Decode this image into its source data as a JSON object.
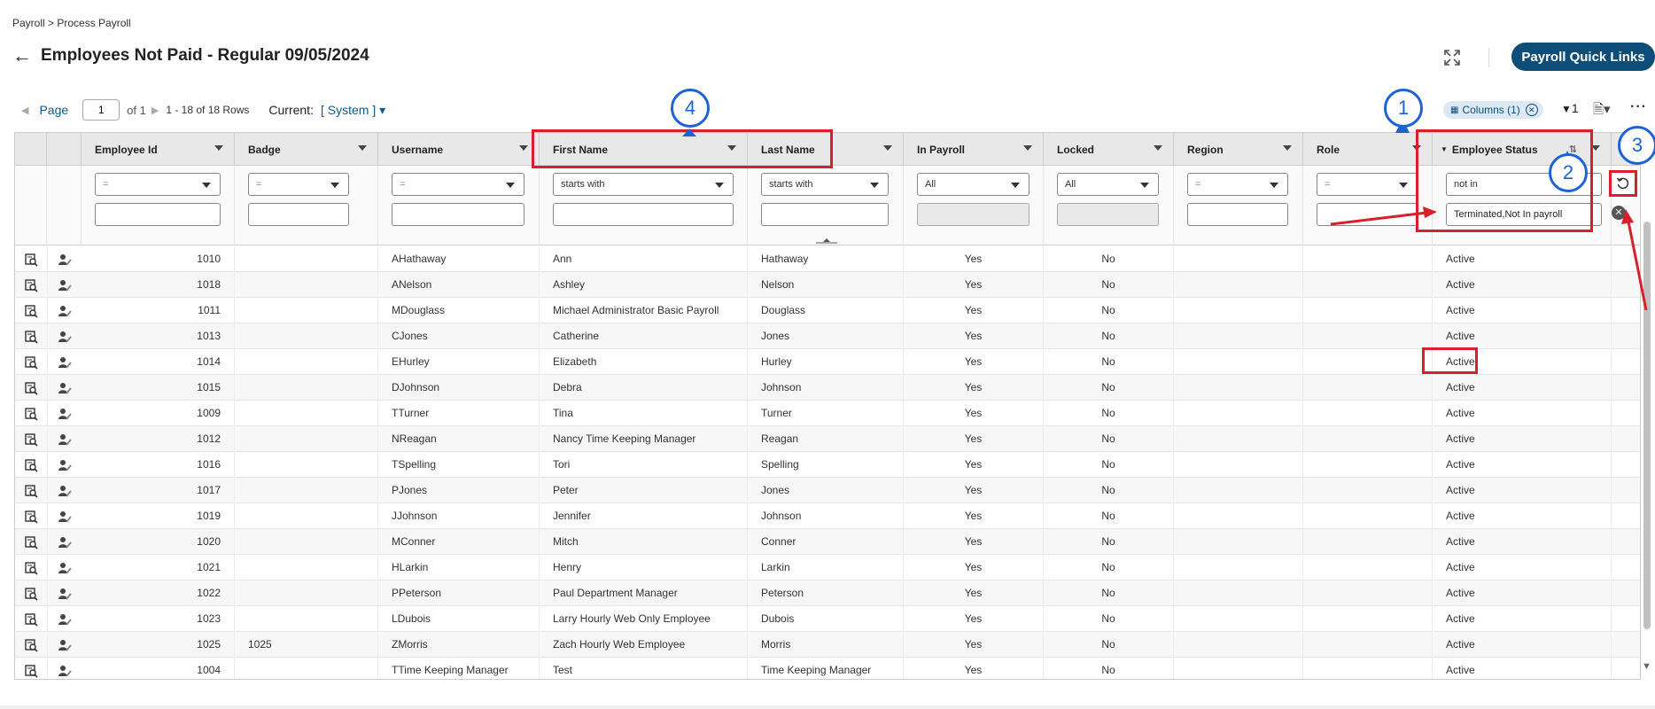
{
  "breadcrumb": "Payroll > Process Payroll",
  "title": "Employees Not Paid - Regular 09/05/2024",
  "quick_links": "Payroll Quick Links",
  "pager": {
    "page_label": "Page",
    "page_value": "1",
    "of_text": "of 1",
    "rows_text": "1 - 18 of 18 Rows",
    "current_label": "Current:",
    "current_value": "[ System ]"
  },
  "toolbar": {
    "columns_chip": "Columns (1)",
    "filter_count": "1"
  },
  "columns": [
    {
      "label": "Employee Id",
      "filter_op": "=",
      "op_placeholder": true,
      "filter_value": "",
      "disabled": false
    },
    {
      "label": "Badge",
      "filter_op": "=",
      "op_placeholder": true,
      "filter_value": "",
      "disabled": false
    },
    {
      "label": "Username",
      "filter_op": "=",
      "op_placeholder": true,
      "filter_value": "",
      "disabled": false
    },
    {
      "label": "First Name",
      "filter_op": "starts with",
      "op_placeholder": false,
      "filter_value": "",
      "disabled": false
    },
    {
      "label": "Last Name",
      "filter_op": "starts with",
      "op_placeholder": false,
      "filter_value": "",
      "disabled": false
    },
    {
      "label": "In Payroll",
      "filter_op": "All",
      "op_placeholder": false,
      "filter_value": "",
      "disabled": true
    },
    {
      "label": "Locked",
      "filter_op": "All",
      "op_placeholder": false,
      "filter_value": "",
      "disabled": true
    },
    {
      "label": "Region",
      "filter_op": "=",
      "op_placeholder": true,
      "filter_value": "",
      "disabled": false
    },
    {
      "label": "Role",
      "filter_op": "=",
      "op_placeholder": true,
      "filter_value": "",
      "disabled": false
    },
    {
      "label": "Employee Status",
      "filter_op": "not in",
      "op_placeholder": false,
      "filter_value": "Terminated,Not In payroll",
      "disabled": false
    }
  ],
  "rows": [
    {
      "id": "1010",
      "badge": "",
      "username": "AHathaway",
      "first": "Ann",
      "last": "Hathaway",
      "in_payroll": "Yes",
      "locked": "No",
      "region": "",
      "role": "",
      "status": "Active"
    },
    {
      "id": "1018",
      "badge": "",
      "username": "ANelson",
      "first": "Ashley",
      "last": "Nelson",
      "in_payroll": "Yes",
      "locked": "No",
      "region": "",
      "role": "",
      "status": "Active"
    },
    {
      "id": "1011",
      "badge": "",
      "username": "MDouglass",
      "first": "Michael Administrator Basic Payroll",
      "last": "Douglass",
      "in_payroll": "Yes",
      "locked": "No",
      "region": "",
      "role": "",
      "status": "Active"
    },
    {
      "id": "1013",
      "badge": "",
      "username": "CJones",
      "first": "Catherine",
      "last": "Jones",
      "in_payroll": "Yes",
      "locked": "No",
      "region": "",
      "role": "",
      "status": "Active"
    },
    {
      "id": "1014",
      "badge": "",
      "username": "EHurley",
      "first": "Elizabeth",
      "last": "Hurley",
      "in_payroll": "Yes",
      "locked": "No",
      "region": "",
      "role": "",
      "status": "Active"
    },
    {
      "id": "1015",
      "badge": "",
      "username": "DJohnson",
      "first": "Debra",
      "last": "Johnson",
      "in_payroll": "Yes",
      "locked": "No",
      "region": "",
      "role": "",
      "status": "Active"
    },
    {
      "id": "1009",
      "badge": "",
      "username": "TTurner",
      "first": "Tina",
      "last": "Turner",
      "in_payroll": "Yes",
      "locked": "No",
      "region": "",
      "role": "",
      "status": "Active"
    },
    {
      "id": "1012",
      "badge": "",
      "username": "NReagan",
      "first": "Nancy Time Keeping Manager",
      "last": "Reagan",
      "in_payroll": "Yes",
      "locked": "No",
      "region": "",
      "role": "",
      "status": "Active"
    },
    {
      "id": "1016",
      "badge": "",
      "username": "TSpelling",
      "first": "Tori",
      "last": "Spelling",
      "in_payroll": "Yes",
      "locked": "No",
      "region": "",
      "role": "",
      "status": "Active"
    },
    {
      "id": "1017",
      "badge": "",
      "username": "PJones",
      "first": "Peter",
      "last": "Jones",
      "in_payroll": "Yes",
      "locked": "No",
      "region": "",
      "role": "",
      "status": "Active"
    },
    {
      "id": "1019",
      "badge": "",
      "username": "JJohnson",
      "first": "Jennifer",
      "last": "Johnson",
      "in_payroll": "Yes",
      "locked": "No",
      "region": "",
      "role": "",
      "status": "Active"
    },
    {
      "id": "1020",
      "badge": "",
      "username": "MConner",
      "first": "Mitch",
      "last": "Conner",
      "in_payroll": "Yes",
      "locked": "No",
      "region": "",
      "role": "",
      "status": "Active"
    },
    {
      "id": "1021",
      "badge": "",
      "username": "HLarkin",
      "first": "Henry",
      "last": "Larkin",
      "in_payroll": "Yes",
      "locked": "No",
      "region": "",
      "role": "",
      "status": "Active"
    },
    {
      "id": "1022",
      "badge": "",
      "username": "PPeterson",
      "first": "Paul Department Manager",
      "last": "Peterson",
      "in_payroll": "Yes",
      "locked": "No",
      "region": "",
      "role": "",
      "status": "Active"
    },
    {
      "id": "1023",
      "badge": "",
      "username": "LDubois",
      "first": "Larry Hourly Web Only Employee",
      "last": "Dubois",
      "in_payroll": "Yes",
      "locked": "No",
      "region": "",
      "role": "",
      "status": "Active"
    },
    {
      "id": "1025",
      "badge": "1025",
      "username": "ZMorris",
      "first": "Zach Hourly Web Employee",
      "last": "Morris",
      "in_payroll": "Yes",
      "locked": "No",
      "region": "",
      "role": "",
      "status": "Active"
    },
    {
      "id": "1004",
      "badge": "",
      "username": "TTime Keeping Manager",
      "first": "Test",
      "last": "Time Keeping Manager",
      "in_payroll": "Yes",
      "locked": "No",
      "region": "",
      "role": "",
      "status": "Active"
    }
  ],
  "annotations": [
    "1",
    "2",
    "3",
    "4"
  ],
  "icons": {
    "back": "arrow-left-icon",
    "expand": "expand-icon",
    "filter": "filter-icon",
    "export": "export-icon",
    "more": "more-horizontal-icon",
    "reset": "reset-filters-icon",
    "clear": "clear-filters-icon",
    "row_view": "view-record-icon",
    "row_edit": "edit-employee-icon"
  },
  "colors": {
    "accent": "#0e4d78",
    "link": "#0e5a8a",
    "annotation_red": "#d8202a",
    "annotation_blue": "#1e63d6"
  }
}
